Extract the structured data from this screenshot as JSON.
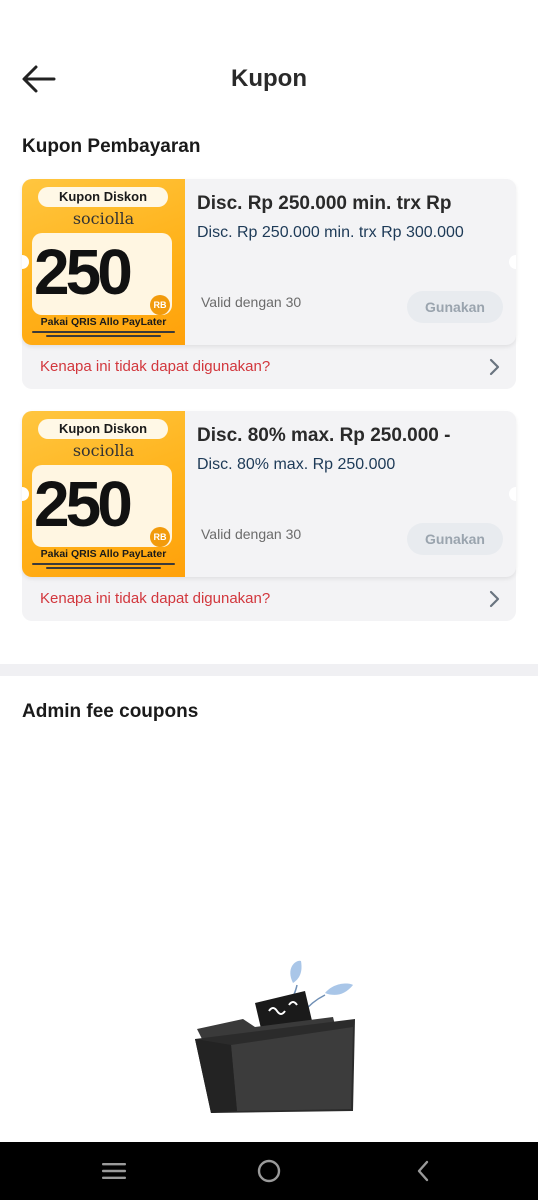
{
  "header": {
    "title": "Kupon",
    "back_icon": "arrow-left-icon"
  },
  "sections": {
    "payment_title": "Kupon Pembayaran",
    "admin_fee_title": "Admin fee coupons"
  },
  "coupons": [
    {
      "banner": {
        "label": "Kupon Diskon",
        "brand": "sociolla",
        "amount": "250",
        "unit": "RB",
        "tagline": "Pakai QRIS Allo PayLater"
      },
      "title": "Disc. Rp 250.000 min. trx Rp",
      "description": "Disc. Rp 250.000 min. trx Rp 300.000",
      "valid": "Valid dengan 30",
      "button": "Gunakan",
      "reason": "Kenapa ini tidak dapat digunakan?"
    },
    {
      "banner": {
        "label": "Kupon Diskon",
        "brand": "sociolla",
        "amount": "250",
        "unit": "RB",
        "tagline": "Pakai QRIS Allo PayLater"
      },
      "title": "Disc. 80% max. Rp 250.000 -",
      "description": "Disc. 80% max. Rp 250.000",
      "valid": "Valid dengan 30",
      "button": "Gunakan",
      "reason": "Kenapa ini tidak dapat digunakan?"
    }
  ],
  "empty_state": {
    "icon": "empty-folder-illustration"
  },
  "system_nav": {
    "menu_icon": "recent-apps-icon",
    "home_icon": "home-circle-icon",
    "back_icon": "chevron-left-icon"
  },
  "colors": {
    "reason_text": "#d2373d",
    "description_text": "#1d3a57",
    "banner_orange": "#ffb21a",
    "disabled_button": "#e8ebef"
  }
}
